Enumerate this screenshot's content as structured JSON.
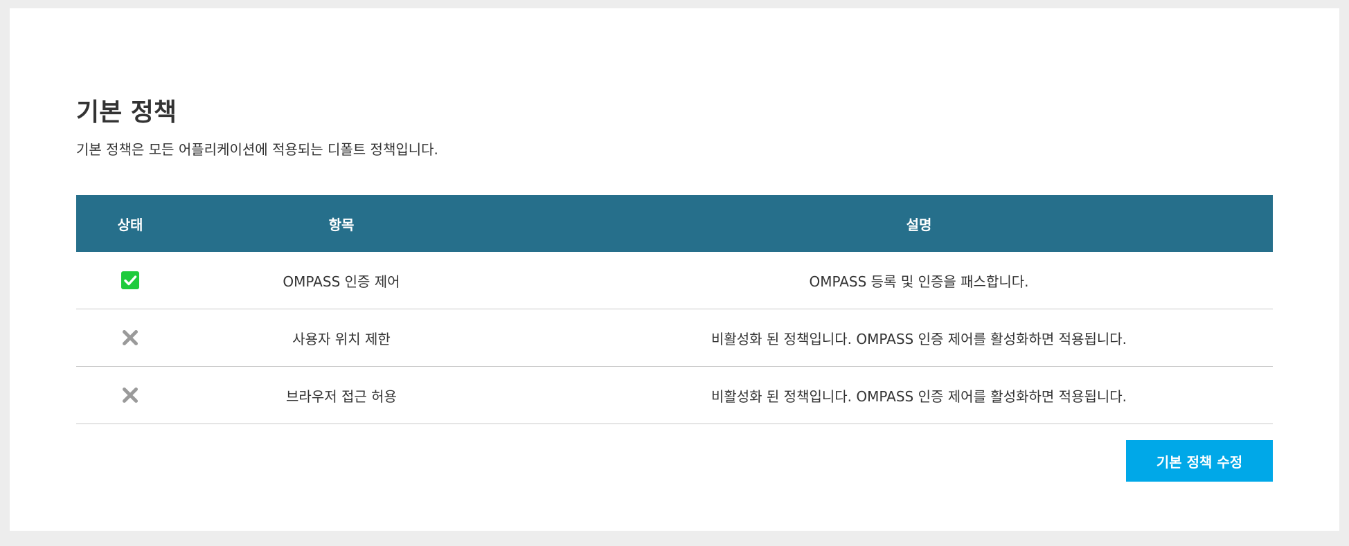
{
  "page": {
    "title": "기본 정책",
    "description": "기본 정책은 모든 어플리케이션에 적용되는 디폴트 정책입니다."
  },
  "table": {
    "headers": {
      "status": "상태",
      "item": "항목",
      "description": "설명"
    },
    "rows": [
      {
        "status": "enabled",
        "status_icon": "check-icon",
        "item": "OMPASS 인증 제어",
        "description": "OMPASS 등록 및 인증을 패스합니다."
      },
      {
        "status": "disabled",
        "status_icon": "x-icon",
        "item": "사용자 위치 제한",
        "description": "비활성화 된 정책입니다. OMPASS 인증 제어를 활성화하면 적용됩니다."
      },
      {
        "status": "disabled",
        "status_icon": "x-icon",
        "item": "브라우저 접근 허용",
        "description": "비활성화 된 정책입니다. OMPASS 인증 제어를 활성화하면 적용됩니다."
      }
    ]
  },
  "actions": {
    "edit_label": "기본 정책 수정"
  },
  "colors": {
    "background": "#ededed",
    "panel": "#ffffff",
    "header": "#266f8b",
    "accent_button": "#00a8e8",
    "enabled": "#1ecb3c",
    "disabled_icon": "#9a9a9a",
    "row_divider": "#c8c8c8"
  }
}
